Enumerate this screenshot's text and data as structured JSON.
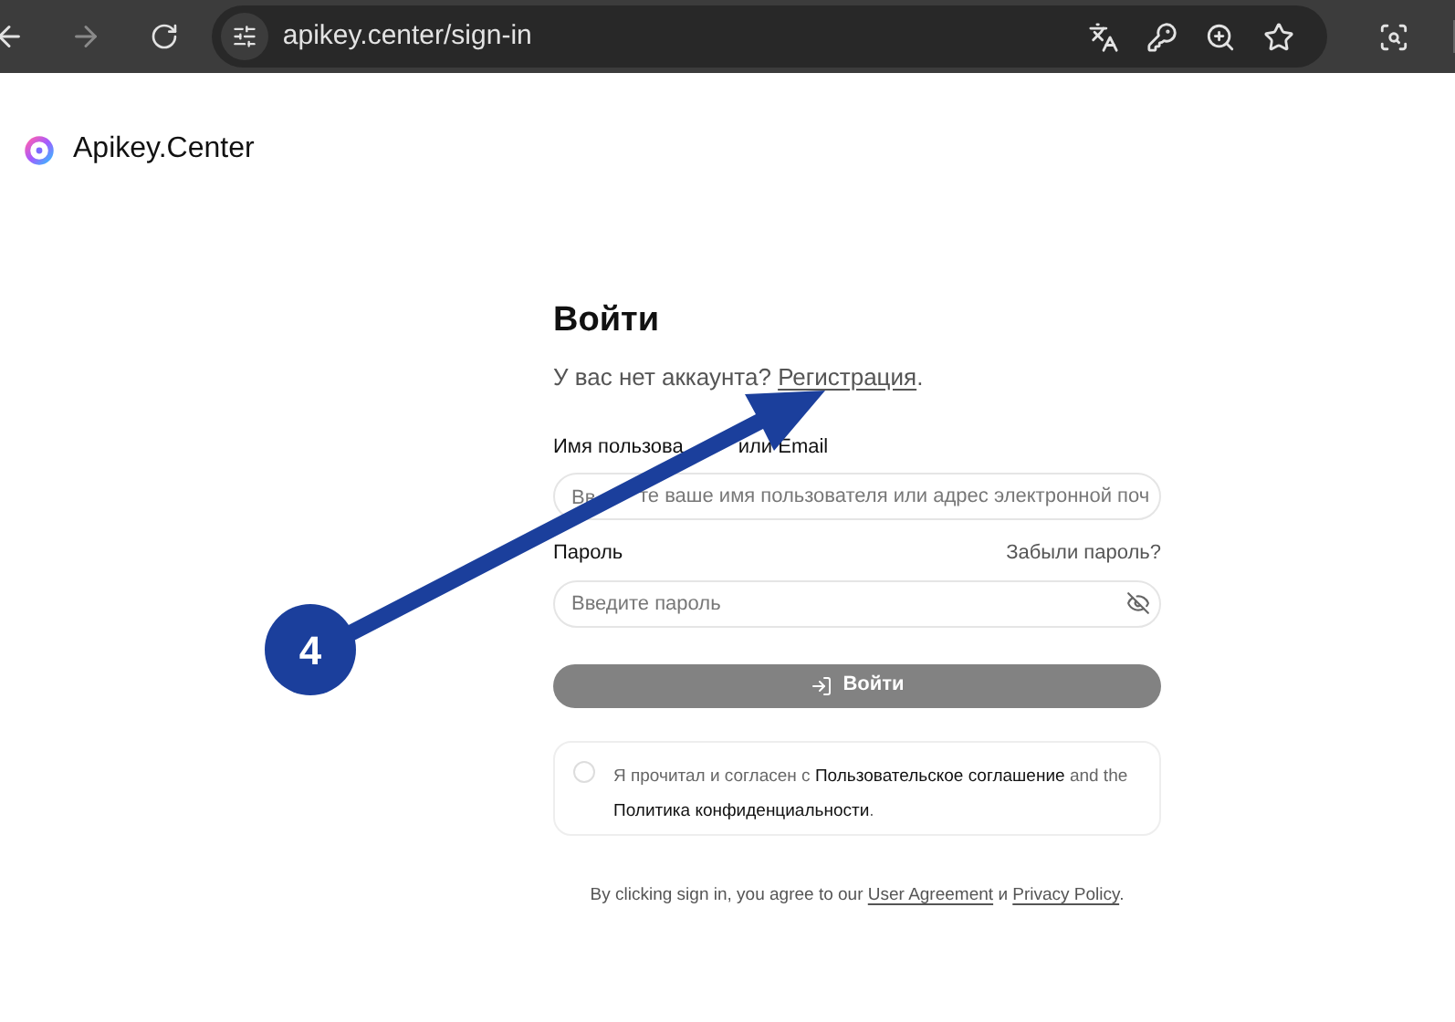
{
  "browser": {
    "url": "apikey.center/sign-in"
  },
  "brand": {
    "name": "Apikey.Center"
  },
  "form": {
    "title": "Войти",
    "signup_prompt": "У вас нет аккаунта?",
    "signup_link": "Регистрация",
    "signup_end": ".",
    "username": {
      "label_parts": [
        "Имя пользова",
        "или Email"
      ],
      "placeholder_start": "Вв",
      "placeholder": "те ваше имя пользователя или адрес электронной поч"
    },
    "password": {
      "label": "Пароль",
      "forgot": "Забыли пароль?",
      "placeholder": "Введите пароль"
    },
    "submit": {
      "label": "Войти",
      "disabled": true
    },
    "agreement": {
      "checked": false,
      "prefix": "Я прочитал и согласен с",
      "link1": "Пользовательское соглашение",
      "middle": "and the",
      "link2": "Политика конфиденциальности",
      "end": "."
    },
    "footer": {
      "prefix": "By clicking sign in, you agree to our",
      "link1": "User Agreement",
      "middle": "и",
      "link2": "Privacy Policy",
      "end": "."
    }
  },
  "annotation": {
    "number": "4"
  }
}
